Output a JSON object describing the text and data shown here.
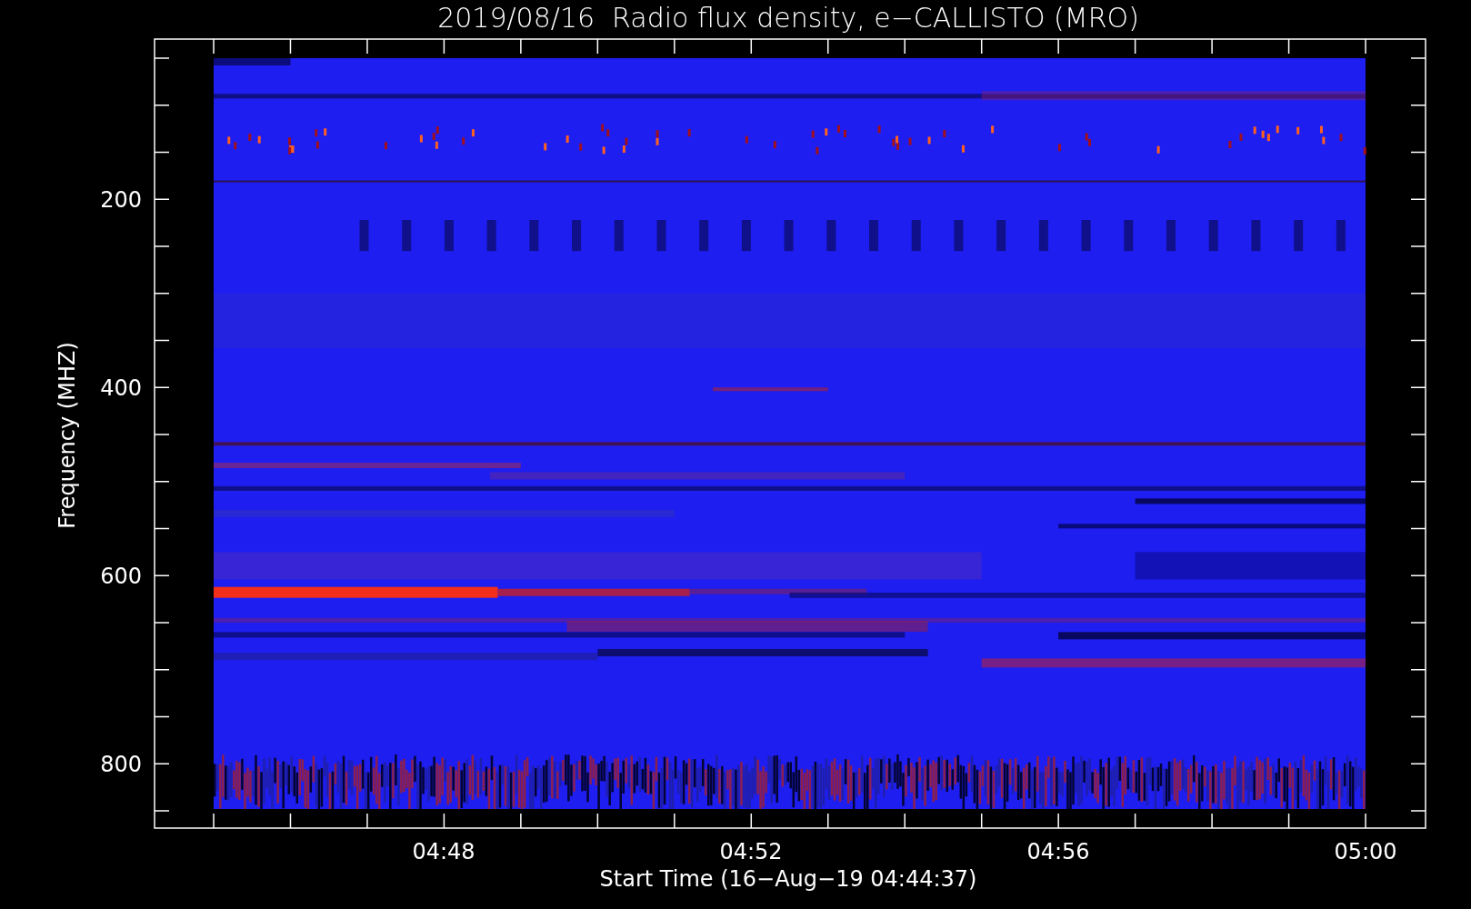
{
  "title": "2019/08/16  Radio flux density, e−CALLISTO (MRO)",
  "y_axis": {
    "label": "Frequency (MHZ)",
    "ticks": [
      "200",
      "400",
      "600",
      "800"
    ]
  },
  "x_axis": {
    "label": "Start Time (16−Aug−19 04:44:37)",
    "ticks": [
      "04:48",
      "04:52",
      "04:56",
      "05:00"
    ]
  }
}
